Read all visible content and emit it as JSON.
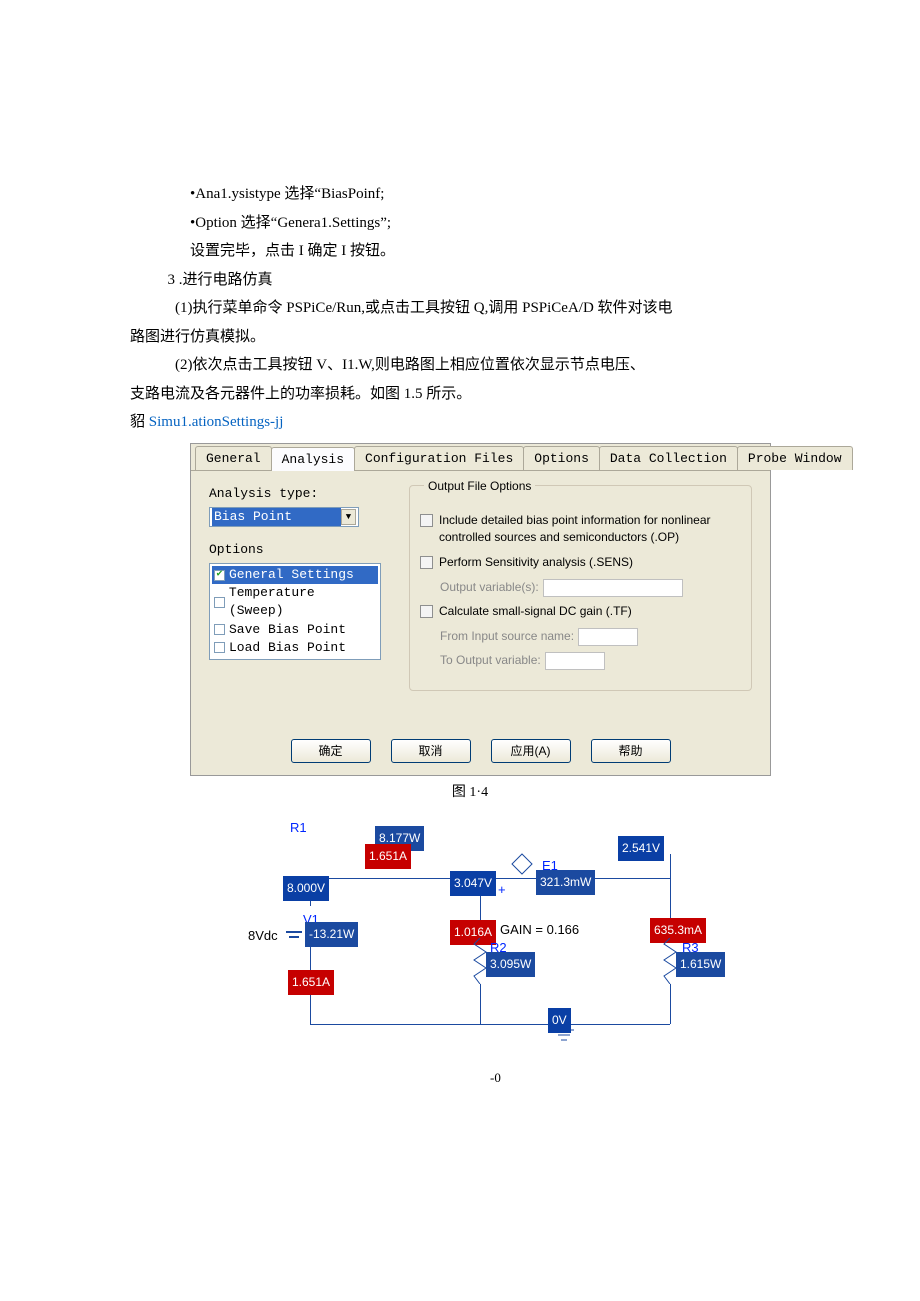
{
  "lines": {
    "l1": "•Ana1.ysistype 选择“BiasPoinf;",
    "l2": "•Option 选择“Genera1.Settings”;",
    "l3": "设置完毕，点击 I 确定 I 按钮。",
    "l4": "3  .进行电路仿真",
    "l5": "(1)执行菜单命令 PSPiCe/Run,或点击工具按钮 Q,调用 PSPiCeA/D 软件对该电",
    "l6": "路图进行仿真模拟。",
    "l7": "(2)依次点击工具按钮 V、I1.W,则电路图上相应位置依次显示节点电压、",
    "l8": "支路电流及各元器件上的功率损耗。如图 1.5 所示。",
    "l9_pre": "貂 ",
    "l9_link": "Simu1.ationSettings-jj"
  },
  "dlg": {
    "tabs": [
      "General",
      "Analysis",
      "Configuration Files",
      "Options",
      "Data Collection",
      "Probe Window"
    ],
    "analysis_type_label": "Analysis type:",
    "analysis_type_value": "Bias Point",
    "options_label": "Options",
    "opts": [
      {
        "label": "General Settings",
        "checked": true,
        "selected": true
      },
      {
        "label": "Temperature (Sweep)",
        "checked": false,
        "selected": false
      },
      {
        "label": "Save Bias Point",
        "checked": false,
        "selected": false
      },
      {
        "label": "Load Bias Point",
        "checked": false,
        "selected": false
      }
    ],
    "group_title": "Output File Options",
    "opt1": "Include detailed bias point information for nonlinear controlled sources and semiconductors (.OP)",
    "opt2": "Perform Sensitivity analysis (.SENS)",
    "opt2_sub_label": "Output variable(s):",
    "opt3": "Calculate small-signal DC gain (.TF)",
    "opt3_sub1": "From Input source name:",
    "opt3_sub2": "To Output variable:",
    "buttons": [
      "确定",
      "取消",
      "应用(A)",
      "帮助"
    ]
  },
  "captions": {
    "fig14": "图 1·4"
  },
  "circuit": {
    "r1": "R1",
    "w1": "8.177W",
    "i1": "1.651A",
    "v_left": "8.000V",
    "v1_label": "V1",
    "p_vsrc": "-13.21W",
    "vsrc": "8Vdc",
    "i_bottom": "1.651A",
    "v_mid": "3.047V",
    "i_mid": "1.016A",
    "r2": "R2",
    "p_r2": "3.095W",
    "gain": "GAIN = 0.166",
    "e1": "E1",
    "p_e1": "321.3mW",
    "v_e1": "2.541V",
    "i_r3": "635.3mA",
    "r3": "R3",
    "p_r3": "1.615W",
    "ov": "0V",
    "zero": "-0"
  }
}
